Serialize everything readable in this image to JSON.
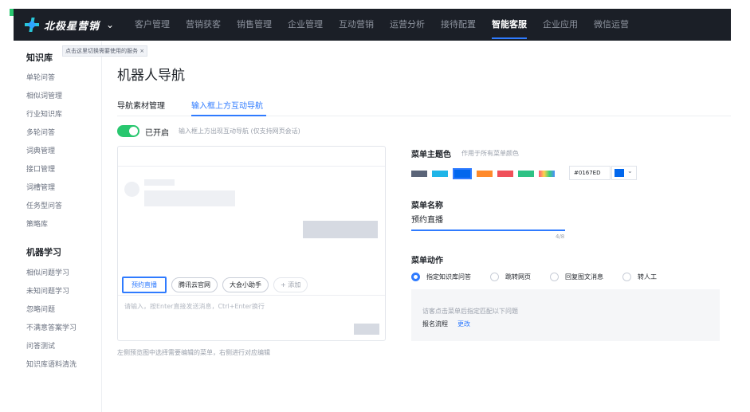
{
  "brand": {
    "name": "北极星营销"
  },
  "nav": {
    "items": [
      "客户管理",
      "营销获客",
      "销售管理",
      "企业管理",
      "互动营销",
      "运营分析",
      "接待配置",
      "智能客服",
      "企业应用",
      "微信运营"
    ],
    "active": "智能客服"
  },
  "sidebar": {
    "tip": "点击这里切换需要使用的服务 ×",
    "knowledge": {
      "title": "知识库",
      "items": [
        "单轮问答",
        "相似词管理",
        "行业知识库",
        "多轮问答",
        "词典管理",
        "接口管理",
        "词槽管理",
        "任务型问答",
        "策略库"
      ]
    },
    "ml": {
      "title": "机器学习",
      "items": [
        "相似问题学习",
        "未知问题学习",
        "忽略问题",
        "不满意答案学习",
        "问答测试",
        "知识库语料清洗"
      ]
    }
  },
  "page": {
    "title": "机器人导航"
  },
  "tabs": [
    "导航素材管理",
    "输入框上方互动导航"
  ],
  "toggle": {
    "label": "已开启",
    "hint": "输入框上方出现互动导航 (仅支持网页会话)"
  },
  "preview": {
    "chips": [
      "预约直播",
      "腾讯云官网",
      "大会小助手",
      "+ 添加"
    ],
    "placeholder": "请输入，按Enter直接发送消息，Ctrl+Enter换行",
    "hint": "左侧预览图中选择需要编辑的菜单，右侧进行对应编辑"
  },
  "theme": {
    "label": "菜单主题色",
    "hint": "作用于所有菜单颜色",
    "swatches": [
      "#5a6478",
      "#1fb5e8",
      "#0167ED",
      "#ff8a2b",
      "#f0505a",
      "#2ec285",
      "gradient"
    ],
    "selected_hex": "#0167ED"
  },
  "menu_name": {
    "label": "菜单名称",
    "value": "预约直播",
    "count": "4/8"
  },
  "menu_action": {
    "label": "菜单动作",
    "options": [
      "指定知识库问答",
      "跳转网页",
      "回复图文消息",
      "转人工"
    ],
    "selected": "指定知识库问答",
    "box_hint": "访客点击菜单后指定匹配以下问题",
    "flow": "报名流程",
    "edit": "更改"
  }
}
